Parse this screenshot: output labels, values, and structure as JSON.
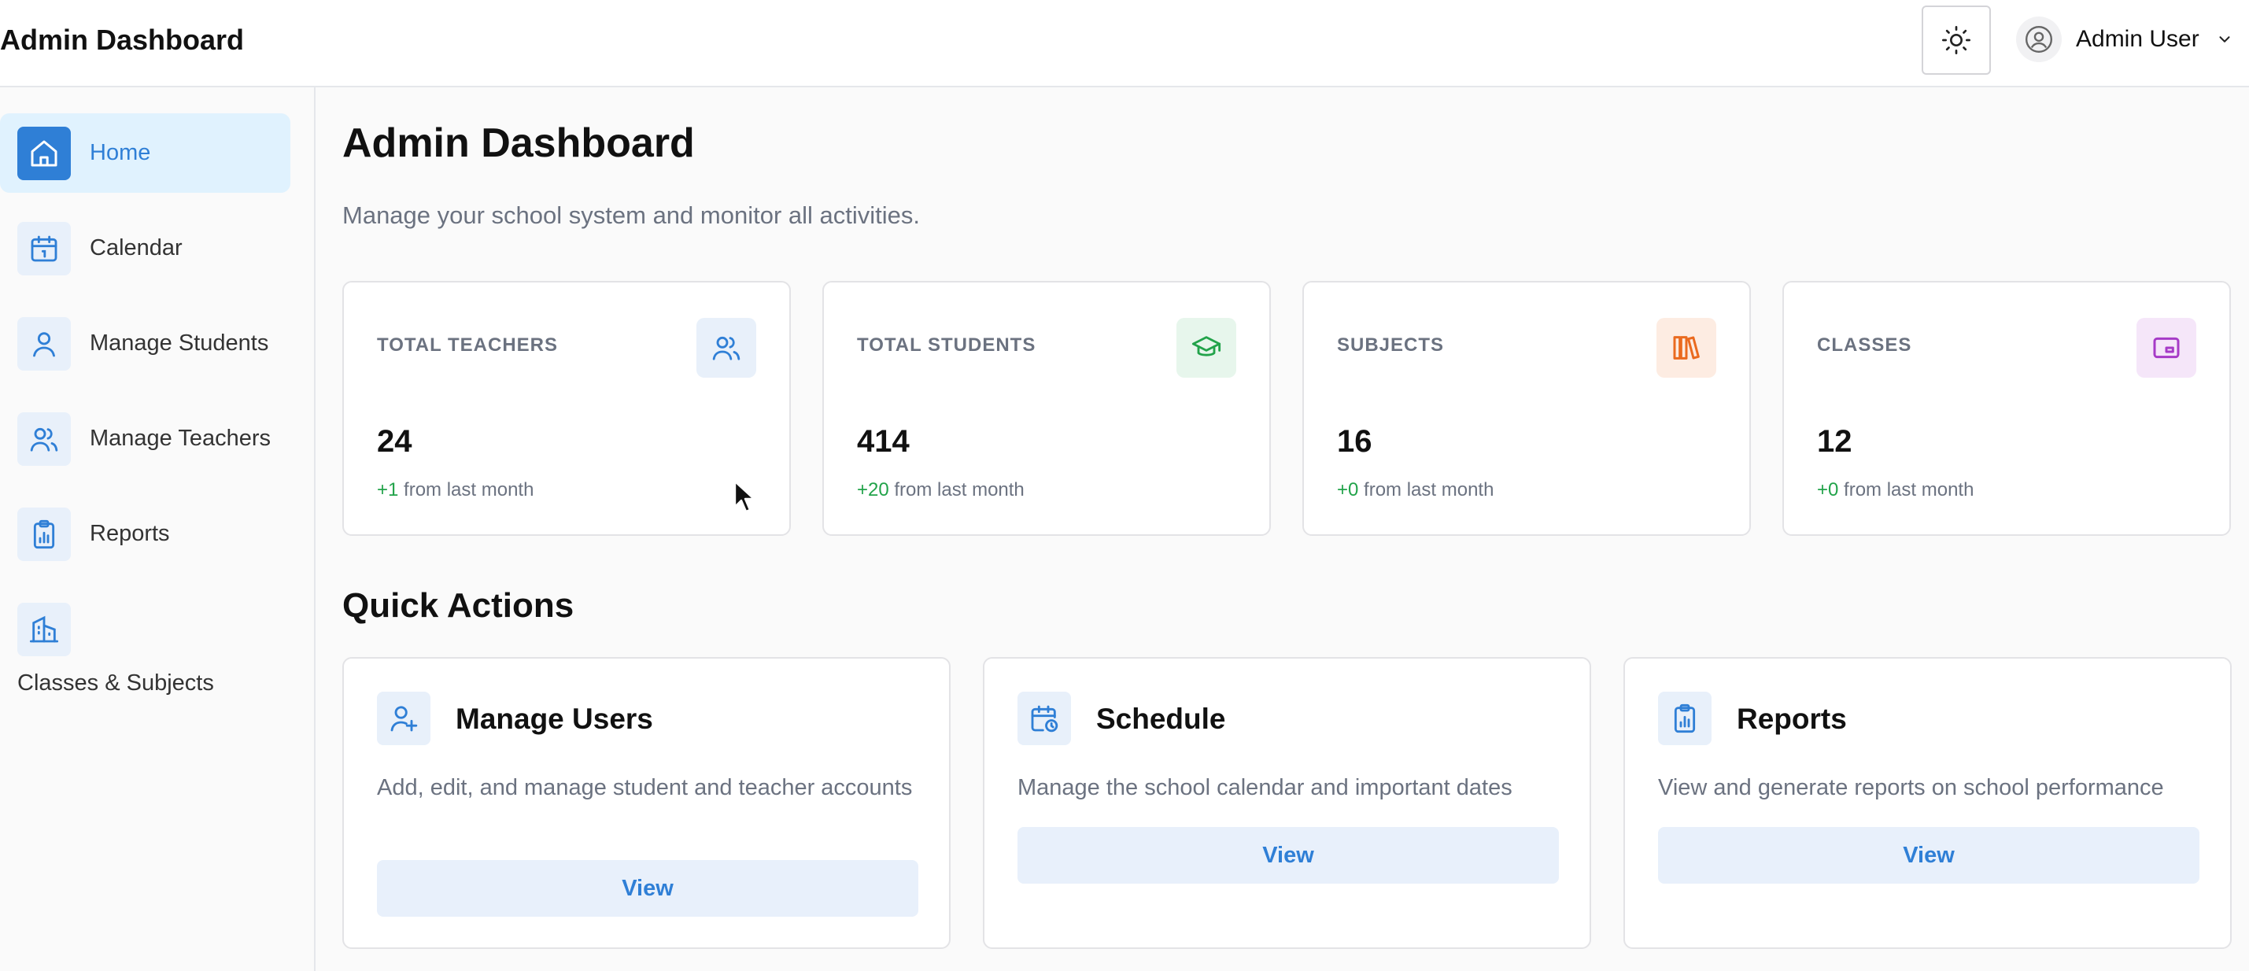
{
  "header": {
    "title": "Admin Dashboard",
    "theme_toggle_icon": "sun-icon",
    "user": {
      "name": "Admin User",
      "avatar_icon": "user-circle-icon"
    }
  },
  "sidebar": {
    "items": [
      {
        "label": "Home",
        "icon": "home-icon",
        "active": true
      },
      {
        "label": "Calendar",
        "icon": "calendar-icon",
        "active": false
      },
      {
        "label": "Manage Students",
        "icon": "user-icon",
        "active": false
      },
      {
        "label": "Manage Teachers",
        "icon": "users-icon",
        "active": false
      },
      {
        "label": "Reports",
        "icon": "clipboard-chart-icon",
        "active": false
      },
      {
        "label": "Classes & Subjects",
        "icon": "building-icon",
        "active": false
      }
    ]
  },
  "main": {
    "title": "Admin Dashboard",
    "subtitle": "Manage your school system and monitor all activities.",
    "stats": [
      {
        "label": "TOTAL TEACHERS",
        "value": "24",
        "change": "+1",
        "change_suffix": " from last month",
        "icon": "users-icon",
        "color": "#2f7fd6",
        "bg": "#e8f0fa"
      },
      {
        "label": "TOTAL STUDENTS",
        "value": "414",
        "change": "+20",
        "change_suffix": " from last month",
        "icon": "graduation-cap-icon",
        "color": "#22a34a",
        "bg": "#e7f6ec"
      },
      {
        "label": "SUBJECTS",
        "value": "16",
        "change": "+0",
        "change_suffix": " from last month",
        "icon": "books-icon",
        "color": "#ea6a1f",
        "bg": "#fdece2"
      },
      {
        "label": "CLASSES",
        "value": "12",
        "change": "+0",
        "change_suffix": " from last month",
        "icon": "presentation-icon",
        "color": "#a63bc7",
        "bg": "#f5e6f9"
      }
    ],
    "quick_actions": {
      "title": "Quick Actions",
      "items": [
        {
          "title": "Manage Users",
          "description": "Add, edit, and manage student and teacher accounts",
          "button": "View",
          "icon": "user-plus-icon"
        },
        {
          "title": "Schedule",
          "description": "Manage the school calendar and important dates",
          "button": "View",
          "icon": "calendar-clock-icon"
        },
        {
          "title": "Reports",
          "description": "View and generate reports on school performance",
          "button": "View",
          "icon": "clipboard-chart-icon"
        }
      ]
    }
  },
  "colors": {
    "accent": "#2f7fd6",
    "positive": "#22a34a",
    "active_nav_bg": "#e0f2fe"
  }
}
